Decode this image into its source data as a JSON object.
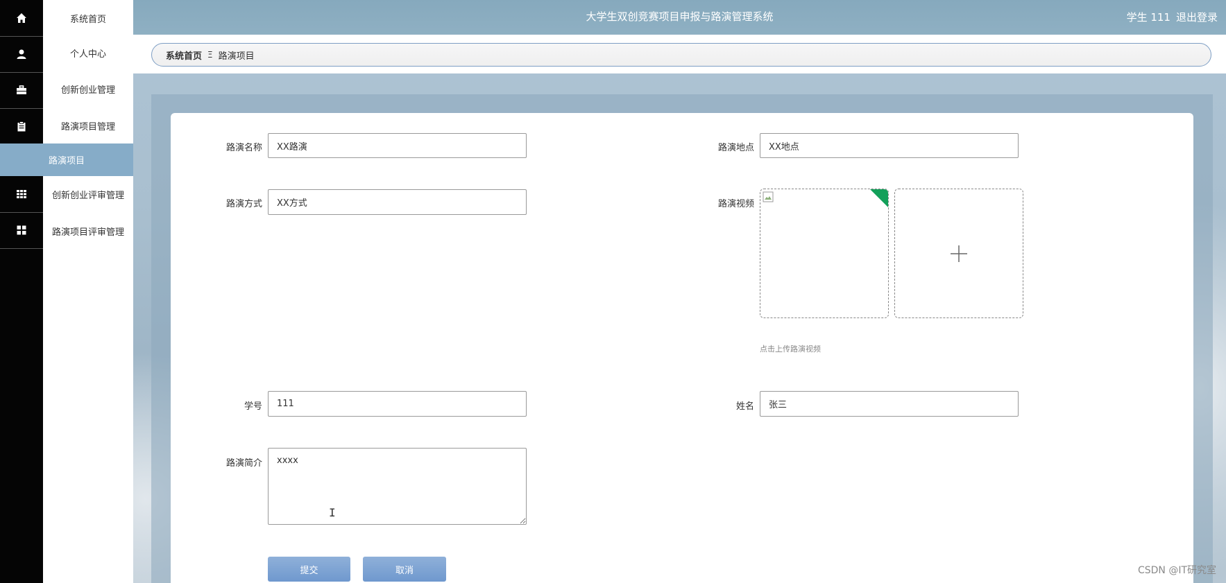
{
  "header": {
    "title": "大学生双创竞赛项目申报与路演管理系统",
    "user": "学生 111",
    "logout": "退出登录"
  },
  "sidebar": {
    "items": [
      {
        "label": "系统首页",
        "icon": "home-icon"
      },
      {
        "label": "个人中心",
        "icon": "user-icon"
      },
      {
        "label": "创新创业管理",
        "icon": "briefcase-icon"
      },
      {
        "label": "路演项目管理",
        "icon": "clipboard-icon"
      },
      {
        "label": "创新创业评审管理",
        "icon": "grid-icon"
      },
      {
        "label": "路演项目评审管理",
        "icon": "dashboard-icon"
      }
    ],
    "active_sub": "路演项目"
  },
  "breadcrumb": {
    "home": "系统首页",
    "separator": "Ξ",
    "current": "路演项目"
  },
  "form": {
    "roadshow_name": {
      "label": "路演名称",
      "value": "XX路演"
    },
    "roadshow_place": {
      "label": "路演地点",
      "value": "XX地点"
    },
    "roadshow_method": {
      "label": "路演方式",
      "value": "XX方式"
    },
    "roadshow_video": {
      "label": "路演视频",
      "tip": "点击上传路演视频"
    },
    "student_id": {
      "label": "学号",
      "value": "111"
    },
    "name": {
      "label": "姓名",
      "value": "张三"
    },
    "intro": {
      "label": "路演简介",
      "value": "xxxx"
    }
  },
  "buttons": {
    "submit": "提交",
    "cancel": "取消"
  },
  "watermark": "CSDN @IT研究室",
  "colors": {
    "sidebar_dark": "#050505",
    "active_menu": "#86acc8",
    "header": "#8aabbf",
    "button": "#7da3d4",
    "upload_success": "#13a05a"
  }
}
